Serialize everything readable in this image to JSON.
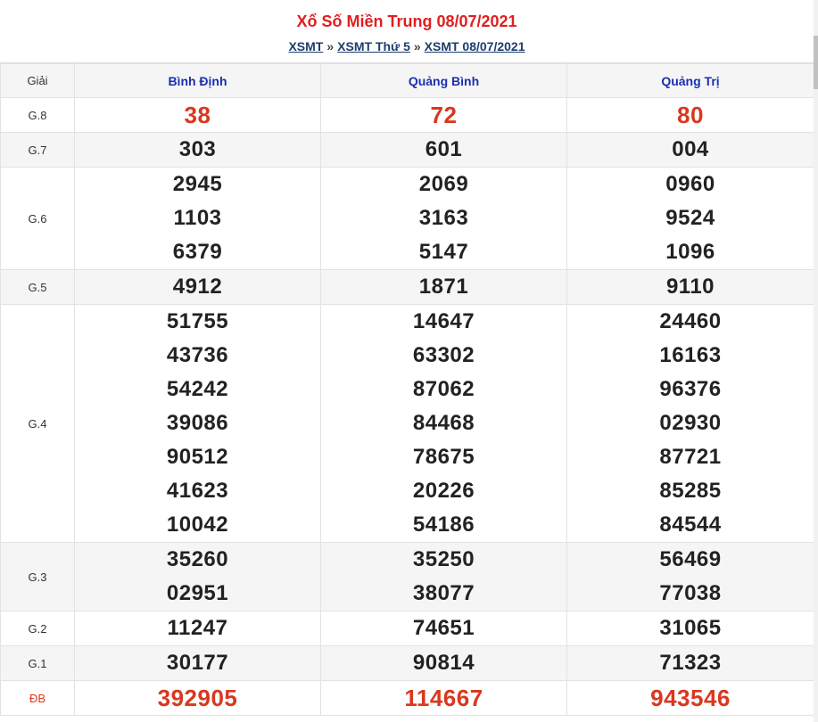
{
  "title": "Xổ Số Miền Trung 08/07/2021",
  "breadcrumb": [
    {
      "label": "XSMT"
    },
    {
      "label": "XSMT Thứ 5"
    },
    {
      "label": "XSMT 08/07/2021"
    }
  ],
  "breadcrumb_separator": "»",
  "table": {
    "header": {
      "prize": "Giải",
      "provinces": [
        "Bình Định",
        "Quảng Bình",
        "Quảng Trị"
      ]
    },
    "rows": [
      {
        "label": "G.8",
        "values": [
          [
            "38"
          ],
          [
            "72"
          ],
          [
            "80"
          ]
        ]
      },
      {
        "label": "G.7",
        "values": [
          [
            "303"
          ],
          [
            "601"
          ],
          [
            "004"
          ]
        ]
      },
      {
        "label": "G.6",
        "values": [
          [
            "2945",
            "1103",
            "6379"
          ],
          [
            "2069",
            "3163",
            "5147"
          ],
          [
            "0960",
            "9524",
            "1096"
          ]
        ]
      },
      {
        "label": "G.5",
        "values": [
          [
            "4912"
          ],
          [
            "1871"
          ],
          [
            "9110"
          ]
        ]
      },
      {
        "label": "G.4",
        "values": [
          [
            "51755",
            "43736",
            "54242",
            "39086",
            "90512",
            "41623",
            "10042"
          ],
          [
            "14647",
            "63302",
            "87062",
            "84468",
            "78675",
            "20226",
            "54186"
          ],
          [
            "24460",
            "16163",
            "96376",
            "02930",
            "87721",
            "85285",
            "84544"
          ]
        ]
      },
      {
        "label": "G.3",
        "values": [
          [
            "35260",
            "02951"
          ],
          [
            "35250",
            "38077"
          ],
          [
            "56469",
            "77038"
          ]
        ]
      },
      {
        "label": "G.2",
        "values": [
          [
            "11247"
          ],
          [
            "74651"
          ],
          [
            "31065"
          ]
        ]
      },
      {
        "label": "G.1",
        "values": [
          [
            "30177"
          ],
          [
            "90814"
          ],
          [
            "71323"
          ]
        ]
      },
      {
        "label": "ĐB",
        "values": [
          [
            "392905"
          ],
          [
            "114667"
          ],
          [
            "943546"
          ]
        ]
      }
    ]
  },
  "colors": {
    "title": "#e01f1f",
    "breadcrumb": "#1e3d6d",
    "province_header": "#1a2fb0",
    "highlight_number": "#d9381e",
    "number": "#222222",
    "alt_row": "#f5f5f5"
  }
}
